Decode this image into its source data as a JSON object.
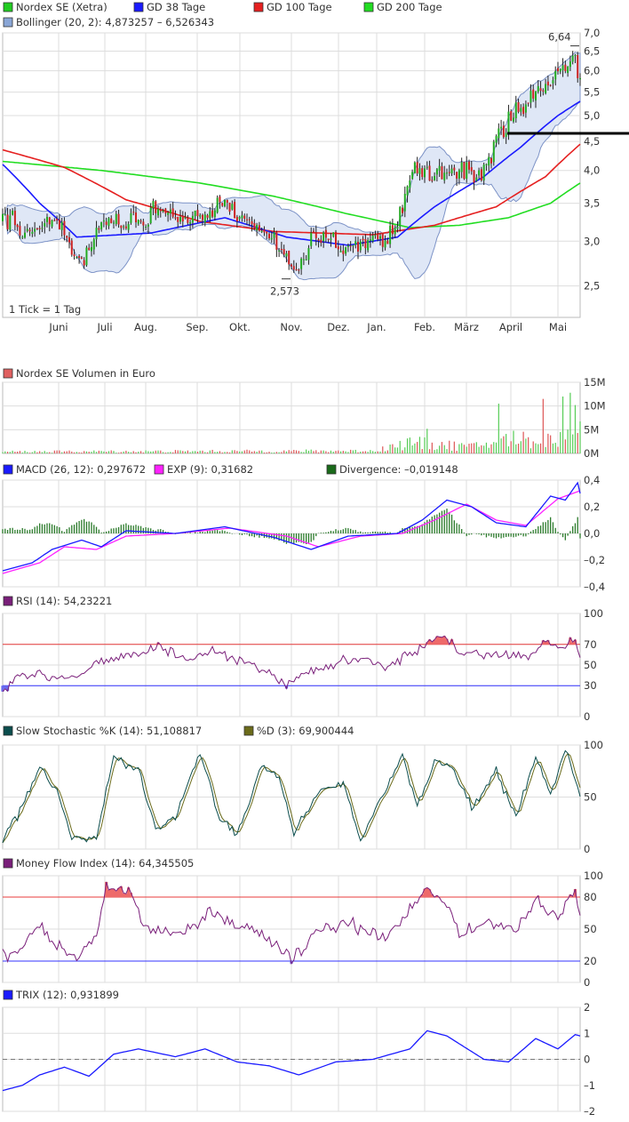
{
  "months": [
    "Juni",
    "Juli",
    "Aug.",
    "Sep.",
    "Okt.",
    "Nov.",
    "Dez.",
    "Jan.",
    "Feb.",
    "März",
    "April",
    "Mai"
  ],
  "colors": {
    "sma38": "#1a1aff",
    "sma100": "#e52020",
    "sma200": "#22dd22",
    "boll": "#8aa6d6",
    "upCandle": "#22aa22",
    "downCandle": "#cc2222",
    "macdHist": "#2a7a2a",
    "exp": "#ff22ff",
    "stochK": "#0b4d4d",
    "stochD": "#6b6b1a",
    "purple": "#7a1f7a",
    "red": "#e83b3b",
    "blue": "#3333ff"
  },
  "panels": {
    "price": {
      "legend": [
        {
          "label": "Nordex SE (Xetra)",
          "color": "#22cc22"
        },
        {
          "label": "GD 38 Tage",
          "color": "#1a1aff"
        },
        {
          "label": "GD 100 Tage",
          "color": "#e52020"
        },
        {
          "label": "GD 200 Tage",
          "color": "#22dd22"
        }
      ],
      "legend2": {
        "label": "Bollinger (20, 2): 4,873257 – 6,526343",
        "color": "#8aa6d6"
      },
      "ticks": [
        "7,0",
        "6,5",
        "6,0",
        "5,5",
        "5,0",
        "4,5",
        "4,0",
        "3,5",
        "3,0",
        "2,5"
      ],
      "high_label": "6,64",
      "low_label": "2,573",
      "note": "1 Tick = 1 Tag"
    },
    "volume": {
      "legend": {
        "label": "Nordex SE Volumen in Euro",
        "color": "#e06060"
      },
      "ticks": [
        "15M",
        "10M",
        "5M",
        "0M"
      ]
    },
    "macd": {
      "legend": [
        {
          "label": "MACD (26, 12): 0,297672",
          "color": "#1a1aff"
        },
        {
          "label": "EXP (9): 0,31682",
          "color": "#ff22ff"
        },
        {
          "label": "Divergence: –0,019148",
          "color": "#1a6a1a"
        }
      ],
      "ticks": [
        "0,4",
        "0,2",
        "0,0",
        "–0,2",
        "–0,4"
      ]
    },
    "rsi": {
      "legend": {
        "label": "RSI (14): 54,23221",
        "color": "#7a1f7a"
      },
      "ticks": [
        "100",
        "70",
        "50",
        "30",
        "0"
      ]
    },
    "stoch": {
      "legend": [
        {
          "label": "Slow Stochastic %K (14): 51,108817",
          "color": "#0b4d4d"
        },
        {
          "label": "%D (3): 69,900444",
          "color": "#6b6b1a"
        }
      ],
      "ticks": [
        "100",
        "50",
        "0"
      ]
    },
    "mfi": {
      "legend": {
        "label": "Money Flow Index (14): 64,345505",
        "color": "#7a1f7a"
      },
      "ticks": [
        "100",
        "80",
        "50",
        "20",
        "0"
      ]
    },
    "trix": {
      "legend": {
        "label": "TRIX (12): 0,931899",
        "color": "#1a1aff"
      },
      "ticks": [
        "2",
        "1",
        "0",
        "–1",
        "–2"
      ]
    }
  },
  "chart_data": [
    {
      "type": "line",
      "title": "Nordex SE (Xetra)",
      "x": [
        "Juni",
        "Juli",
        "Aug.",
        "Sep.",
        "Okt.",
        "Nov.",
        "Dez.",
        "Jan.",
        "Feb.",
        "März",
        "April",
        "Mai"
      ],
      "series": [
        {
          "name": "Nordex SE (Xetra)",
          "values": [
            3.2,
            2.9,
            3.2,
            3.4,
            3.2,
            2.8,
            2.95,
            3.6,
            4.0,
            4.0,
            5.1,
            6.0
          ]
        },
        {
          "name": "GD 38 Tage",
          "values": [
            3.6,
            3.1,
            3.1,
            3.3,
            3.25,
            3.05,
            2.95,
            3.1,
            3.6,
            3.9,
            4.4,
            5.3
          ]
        },
        {
          "name": "GD 100 Tage",
          "values": [
            4.25,
            3.75,
            3.4,
            3.25,
            3.15,
            3.1,
            3.08,
            3.05,
            3.25,
            3.45,
            3.9,
            4.4
          ]
        },
        {
          "name": "GD 200 Tage",
          "values": [
            4.1,
            3.95,
            3.82,
            3.7,
            3.57,
            3.42,
            3.28,
            3.18,
            3.17,
            3.22,
            3.4,
            3.75
          ]
        }
      ],
      "ylim": [
        2.2,
        7.0
      ],
      "annotations": [
        {
          "label": "6,64",
          "value": 6.64
        },
        {
          "label": "2,573",
          "value": 2.573
        }
      ]
    },
    {
      "type": "bar",
      "title": "Nordex SE Volumen in Euro",
      "x": [
        "Juni",
        "Juli",
        "Aug.",
        "Sep.",
        "Okt.",
        "Nov.",
        "Dez.",
        "Jan.",
        "Feb.",
        "März",
        "April",
        "Mai"
      ],
      "values_million": [
        0.5,
        0.5,
        0.5,
        0.6,
        0.6,
        1.0,
        0.8,
        3.0,
        2.5,
        2.5,
        3.5,
        6.0
      ],
      "ylim": [
        0,
        15
      ]
    },
    {
      "type": "line",
      "title": "MACD (26, 12)",
      "x": [
        "Juni",
        "Juli",
        "Aug.",
        "Sep.",
        "Okt.",
        "Nov.",
        "Dez.",
        "Jan.",
        "Feb.",
        "März",
        "April",
        "Mai"
      ],
      "series": [
        {
          "name": "MACD (26, 12): 0,297672",
          "values": [
            -0.2,
            -0.1,
            0.0,
            0.02,
            0.0,
            -0.12,
            0.0,
            0.05,
            0.28,
            0.05,
            0.25,
            0.3
          ]
        },
        {
          "name": "EXP (9): 0,31682",
          "values": [
            -0.25,
            -0.15,
            0.0,
            0.02,
            0.0,
            -0.08,
            0.0,
            0.05,
            0.22,
            0.08,
            0.22,
            0.32
          ]
        },
        {
          "name": "Divergence: –0,019148",
          "values": [
            0.02,
            0.08,
            0.02,
            0.01,
            0.0,
            -0.03,
            0.0,
            0.05,
            0.03,
            -0.04,
            0.03,
            -0.02
          ]
        }
      ],
      "ylim": [
        -0.4,
        0.4
      ]
    },
    {
      "type": "line",
      "title": "RSI (14)",
      "x": [
        "Juni",
        "Juli",
        "Aug.",
        "Sep.",
        "Okt.",
        "Nov.",
        "Dez.",
        "Jan.",
        "Feb.",
        "März",
        "April",
        "Mai"
      ],
      "series": [
        {
          "name": "RSI (14): 54,23221",
          "values": [
            40,
            45,
            60,
            58,
            50,
            35,
            55,
            60,
            62,
            58,
            65,
            54
          ]
        }
      ],
      "ylim": [
        0,
        100
      ],
      "bands": [
        30,
        70
      ]
    },
    {
      "type": "line",
      "title": "Slow Stochastic",
      "x": [
        "Juni",
        "Juli",
        "Aug.",
        "Sep.",
        "Okt.",
        "Nov.",
        "Dez.",
        "Jan.",
        "Feb.",
        "März",
        "April",
        "Mai"
      ],
      "series": [
        {
          "name": "Slow Stochastic %K (14): 51,108817",
          "values": [
            20,
            30,
            80,
            20,
            90,
            25,
            50,
            80,
            60,
            40,
            80,
            51
          ]
        },
        {
          "name": "%D (3): 69,900444",
          "values": [
            22,
            32,
            78,
            22,
            88,
            27,
            50,
            78,
            60,
            42,
            78,
            70
          ]
        }
      ],
      "ylim": [
        0,
        100
      ]
    },
    {
      "type": "line",
      "title": "Money Flow Index (14)",
      "x": [
        "Juni",
        "Juli",
        "Aug.",
        "Sep.",
        "Okt.",
        "Nov.",
        "Dez.",
        "Jan.",
        "Feb.",
        "März",
        "April",
        "Mai"
      ],
      "series": [
        {
          "name": "Money Flow Index (14): 64,345505",
          "values": [
            30,
            45,
            75,
            50,
            55,
            30,
            50,
            70,
            55,
            60,
            70,
            64
          ]
        }
      ],
      "ylim": [
        0,
        100
      ],
      "bands": [
        20,
        80
      ]
    },
    {
      "type": "line",
      "title": "TRIX (12)",
      "x": [
        "Juni",
        "Juli",
        "Aug.",
        "Sep.",
        "Okt.",
        "Nov.",
        "Dez.",
        "Jan.",
        "Feb.",
        "März",
        "April",
        "Mai"
      ],
      "series": [
        {
          "name": "TRIX (12): 0,931899",
          "values": [
            -1.2,
            -0.6,
            0.3,
            0.3,
            0.2,
            -0.5,
            0.1,
            0.6,
            1.2,
            0.1,
            0.9,
            0.93
          ]
        }
      ],
      "ylim": [
        -2,
        2
      ]
    }
  ]
}
